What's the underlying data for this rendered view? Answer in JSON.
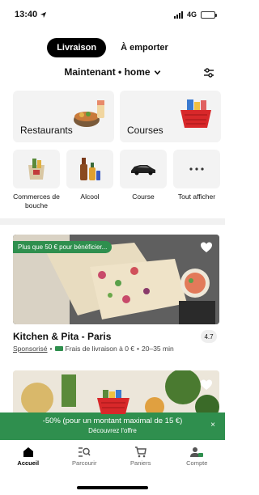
{
  "status": {
    "time": "13:40",
    "network": "4G"
  },
  "mode_toggle": {
    "delivery": "Livraison",
    "pickup": "À emporter"
  },
  "location": {
    "text": "Maintenant • home"
  },
  "categories_big": [
    {
      "label": "Restaurants",
      "icon": "food-bowl-icon"
    },
    {
      "label": "Courses",
      "icon": "grocery-basket-icon"
    }
  ],
  "categories_small": [
    {
      "label": "Commerces de bouche",
      "icon": "deli-bag-icon"
    },
    {
      "label": "Alcool",
      "icon": "bottles-icon"
    },
    {
      "label": "Course",
      "icon": "car-icon"
    },
    {
      "label": "Tout afficher",
      "icon": "more-icon"
    }
  ],
  "store_card": {
    "promo": "Plus que 50 € pour bénéficier...",
    "title": "Kitchen & Pita - Paris",
    "rating": "4.7",
    "sponsored": "Sponsorisé",
    "delivery": "Frais de livraison à 0 €",
    "time": "20–35 min",
    "separator": "•"
  },
  "banner": {
    "main": "-50% (pour un montant maximal de 15 €)",
    "sub": "Découvrez l'offre",
    "close": "×"
  },
  "tabs": [
    {
      "label": "Accueil",
      "icon": "home-icon"
    },
    {
      "label": "Parcourir",
      "icon": "search-list-icon"
    },
    {
      "label": "Paniers",
      "icon": "cart-icon"
    },
    {
      "label": "Compte",
      "icon": "account-icon"
    }
  ],
  "colors": {
    "brand_green": "#2f8f4e",
    "accent_black": "#000000"
  }
}
